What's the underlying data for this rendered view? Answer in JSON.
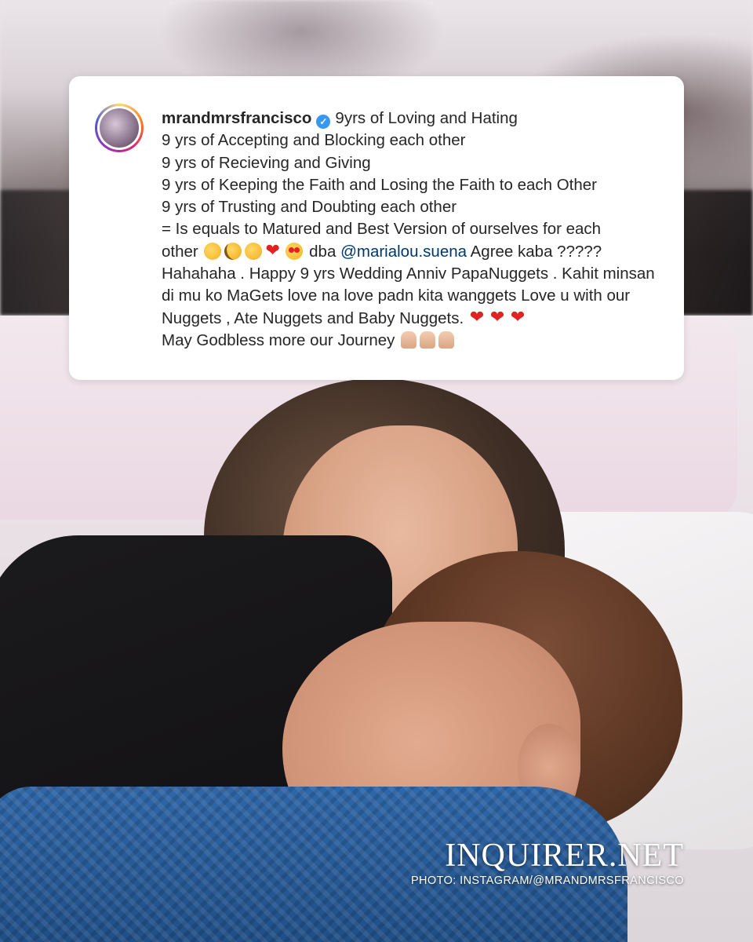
{
  "post": {
    "username": "mrandmrsfrancisco",
    "verified_icon": "verified-badge-icon",
    "caption_lines": [
      "9yrs of Loving and Hating",
      "9 yrs of Accepting and Blocking each other",
      "9 yrs of Recieving and Giving",
      "9 yrs of Keeping the Faith and Losing the Faith to each Other",
      "9 yrs of Trusting and Doubting each other",
      "= Is equals to Matured and Best Version of ourselves for each"
    ],
    "line7_prefix": "other",
    "line7_mid": "dba",
    "mention": "@marialou.suena",
    "line7_suffix": "Agree kaba ?????",
    "body_text": "Hahahaha . Happy 9 yrs Wedding Anniv PapaNuggets . Kahit minsan di mu ko MaGets love na love padn kita wanggets Love u with our Nuggets , Ate Nuggets and Baby Nuggets.",
    "closing": "May Godbless more our Journey",
    "emojis_row": [
      "shushing-face-icon",
      "monocle-face-icon",
      "smiling-face-with-hearts-icon",
      "red-heart-icon",
      "heart-eyes-icon"
    ],
    "hearts_after_body": [
      "red-heart-icon",
      "red-heart-icon",
      "red-heart-icon"
    ],
    "pray_icons": [
      "folded-hands-icon",
      "folded-hands-icon",
      "folded-hands-icon"
    ]
  },
  "watermark": {
    "brand": "INQUIRER.NET",
    "credit": "PHOTO: INSTAGRAM/@MRANDMRSFRANCISCO"
  },
  "colors": {
    "mention": "#00376b",
    "verified": "#3897f0",
    "text": "#262626",
    "card_bg": "#ffffff"
  }
}
